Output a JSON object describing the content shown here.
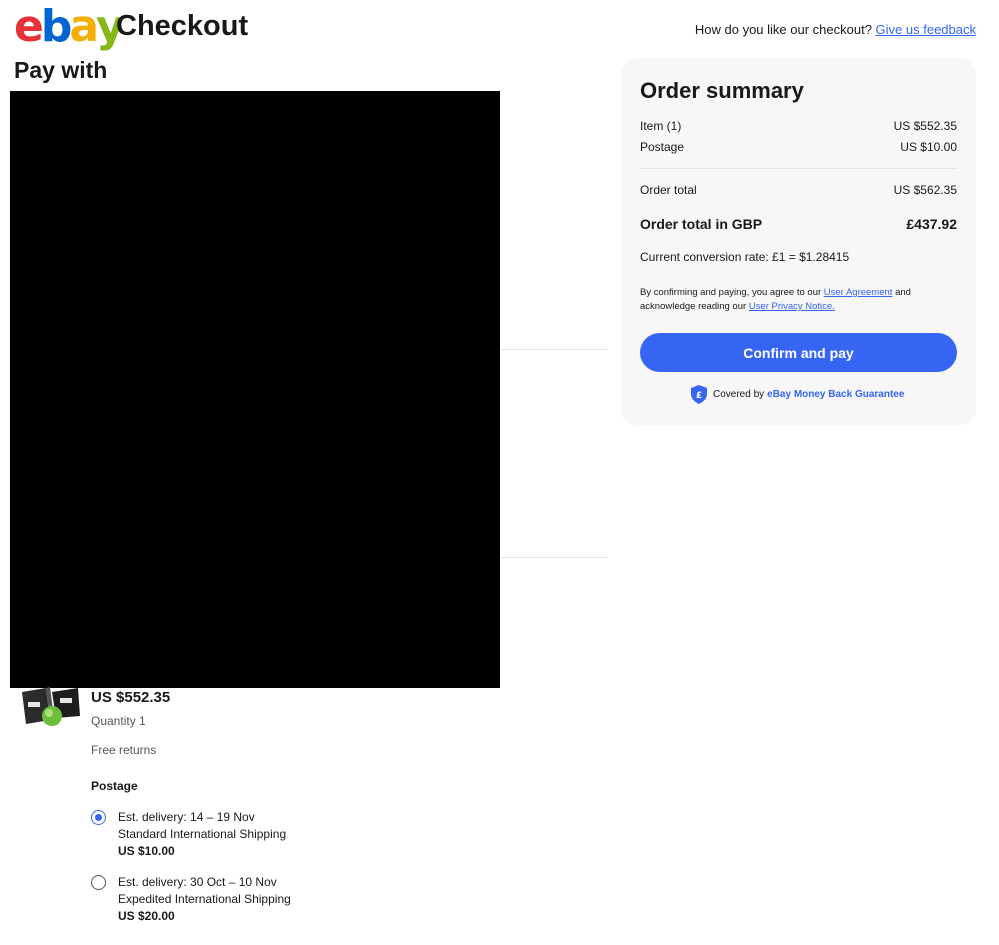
{
  "header": {
    "logo": {
      "e": "e",
      "b": "b",
      "a": "a",
      "y": "y"
    },
    "title": "Checkout",
    "feedback_question": "How do you like our checkout?",
    "feedback_link": "Give us feedback"
  },
  "main": {
    "section_title": "Pay with",
    "item": {
      "price": "US $552.35",
      "quantity": "Quantity 1",
      "returns": "Free returns",
      "postage_heading": "Postage"
    },
    "shipping_options": [
      {
        "delivery": "Est. delivery: 14 – 19 Nov",
        "service": "Standard International Shipping",
        "price": "US $10.00",
        "selected": true
      },
      {
        "delivery": "Est. delivery: 30 Oct – 10 Nov",
        "service": "Expedited International Shipping",
        "price": "US $20.00",
        "selected": false
      }
    ]
  },
  "summary": {
    "title": "Order summary",
    "items_label": "Item (1)",
    "items_value": "US $552.35",
    "postage_label": "Postage",
    "postage_value": "US $10.00",
    "total_label": "Order total",
    "total_value": "US $562.35",
    "gbp_label": "Order total in GBP",
    "gbp_value": "£437.92",
    "conversion": "Current conversion rate: £1 = $1.28415",
    "legal_pre": "By confirming and paying, you agree to our",
    "legal_link1": "User Agreement",
    "legal_mid": "and acknowledge reading our",
    "legal_link2": "User Privacy Notice.",
    "confirm_button": "Confirm and pay",
    "covered_by": "Covered by",
    "guarantee_link": "eBay Money Back Guarantee"
  },
  "colors": {
    "primary": "#3665f3",
    "redacted": "#000000",
    "panel": "#f7f7f7"
  }
}
